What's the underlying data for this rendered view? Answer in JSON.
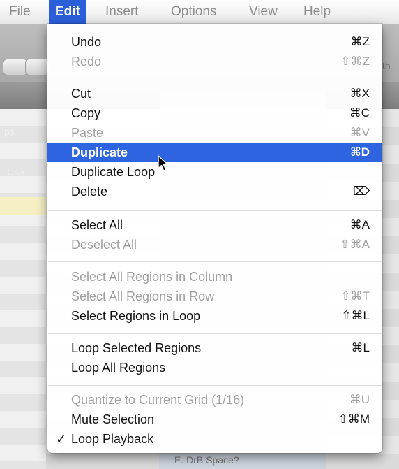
{
  "menubar": {
    "items": [
      "File",
      "Edit",
      "Insert",
      "Options",
      "View",
      "Help"
    ],
    "active": "Edit"
  },
  "menu": {
    "items": [
      {
        "label": "Undo",
        "shortcut": "⌘Z",
        "enabled": true
      },
      {
        "label": "Redo",
        "shortcut": "⇧⌘Z",
        "enabled": false
      },
      {
        "label": "Cut",
        "shortcut": "⌘X",
        "enabled": true
      },
      {
        "label": "Copy",
        "shortcut": "⌘C",
        "enabled": true
      },
      {
        "label": "Paste",
        "shortcut": "⌘V",
        "enabled": false
      },
      {
        "label": "Duplicate",
        "shortcut": "⌘D",
        "enabled": true,
        "selected": true
      },
      {
        "label": "Duplicate Loop",
        "shortcut": "",
        "enabled": true
      },
      {
        "label": "Delete",
        "shortcut": "⌦",
        "enabled": true
      },
      {
        "label": "Select All",
        "shortcut": "⌘A",
        "enabled": true
      },
      {
        "label": "Deselect All",
        "shortcut": "⇧⌘A",
        "enabled": false
      },
      {
        "label": "Select All Regions in Column",
        "shortcut": "",
        "enabled": false
      },
      {
        "label": "Select All Regions in Row",
        "shortcut": "⇧⌘T",
        "enabled": false
      },
      {
        "label": "Select Regions in Loop",
        "shortcut": "⇧⌘L",
        "enabled": true
      },
      {
        "label": "Loop Selected Regions",
        "shortcut": "⌘L",
        "enabled": true
      },
      {
        "label": "Loop All Regions",
        "shortcut": "",
        "enabled": true
      },
      {
        "label": "Quantize to Current Grid (1/16)",
        "shortcut": "⌘U",
        "enabled": false
      },
      {
        "label": "Mute Selection",
        "shortcut": "⇧⌘M",
        "enabled": true
      },
      {
        "label": "Loop Playback",
        "shortcut": "",
        "enabled": true,
        "checked": true,
        "check_mark": "✓"
      }
    ]
  },
  "background": {
    "ghost_labels": [
      "th",
      "ps",
      "Use",
      "E. DrB Space?"
    ]
  },
  "colors": {
    "selection": "#2f64e0",
    "menubar_active": "#2b5fd9",
    "disabled_text": "#a0a0a0"
  }
}
